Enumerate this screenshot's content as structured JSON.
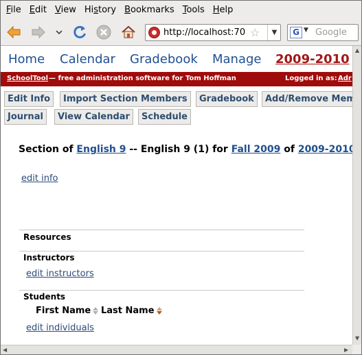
{
  "menu": [
    "File",
    "Edit",
    "View",
    "History",
    "Bookmarks",
    "Tools",
    "Help"
  ],
  "menu_accel": [
    "F",
    "E",
    "V",
    "s",
    "B",
    "T",
    "H"
  ],
  "url": "http://localhost:70",
  "search_placeholder": "Google",
  "topnav": [
    "Home",
    "Calendar",
    "Gradebook",
    "Manage",
    "2009-2010"
  ],
  "banner": {
    "brand": "SchoolTool",
    "tagline": "— free administration software for Tom Hoffman",
    "logged_in_label": "Logged in as:",
    "user": "Adr"
  },
  "actions_row1": [
    "Edit Info",
    "Import Section Members",
    "Gradebook",
    "Add/Remove Mem"
  ],
  "actions_row2": [
    "Journal",
    "View Calendar",
    "Schedule"
  ],
  "section": {
    "prefix": "Section of",
    "course": "English 9",
    "middle": "-- English 9 (1) for",
    "term": "Fall 2009",
    "of": "of",
    "year": "2009-2010"
  },
  "edit_info_link": "edit info",
  "resources_heading": "Resources",
  "instructors_heading": "Instructors",
  "edit_instructors_link": "edit instructors",
  "students_heading": "Students",
  "students_columns": [
    "First Name",
    "Last Name"
  ],
  "edit_individuals_link": "edit individuals",
  "colors": {
    "nav_link": "#1f4f8f",
    "nav_current": "#a21717",
    "banner_bg": "#a00b0b",
    "button_text": "#2d4d6f"
  }
}
